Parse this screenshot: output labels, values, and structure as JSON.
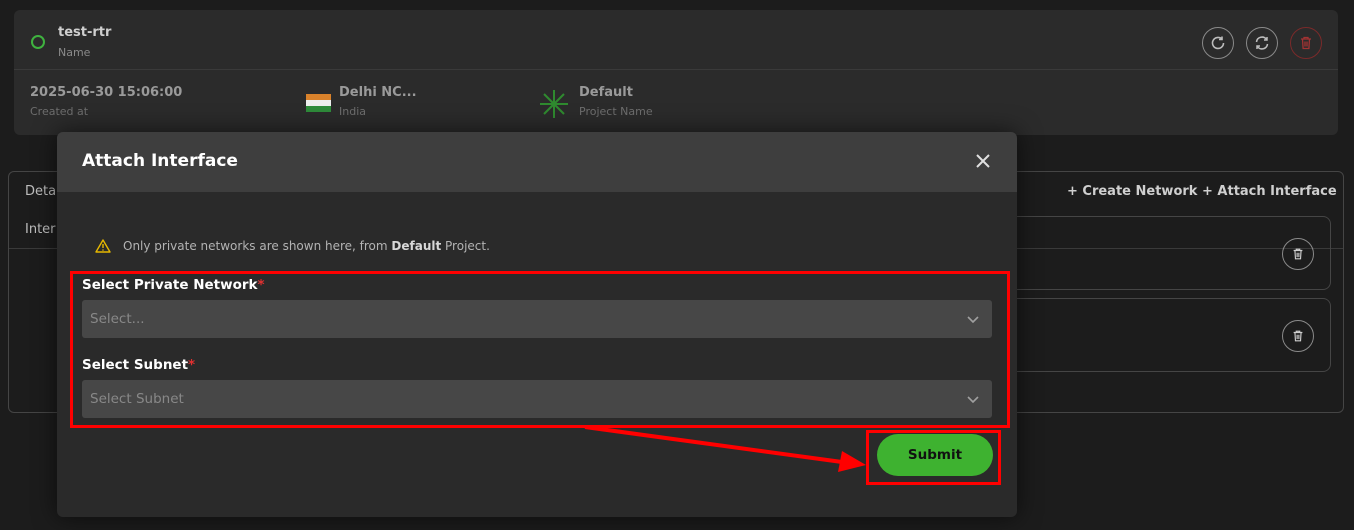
{
  "router": {
    "name": "test-rtr",
    "name_label": "Name",
    "status_color": "#3fb23f",
    "created_at": "2025-06-30 15:06:00",
    "created_at_label": "Created at",
    "location": "Delhi NC...",
    "country": "India",
    "project": "Default",
    "project_label": "Project Name",
    "actions": [
      "reboot-icon",
      "sync-icon",
      "trash-icon"
    ]
  },
  "panel": {
    "tab_details": "Deta",
    "tab_interfaces": "Inter",
    "create_network": "+ Create Network",
    "attach_interface": "+ Attach Interface"
  },
  "modal": {
    "title": "Attach Interface",
    "close_label": "×",
    "note_prefix": "Only private networks are shown here, from ",
    "note_project": "Default",
    "note_suffix": " Project.",
    "network_label": "Select Private Network",
    "network_placeholder": "Select...",
    "subnet_label": "Select Subnet",
    "subnet_placeholder": "Select Subnet",
    "required_mark": "*",
    "submit": "Submit"
  },
  "colors": {
    "accent": "#3eb230",
    "annotation": "#ff0000",
    "warning": "#e6b800",
    "danger": "#c0392b"
  }
}
